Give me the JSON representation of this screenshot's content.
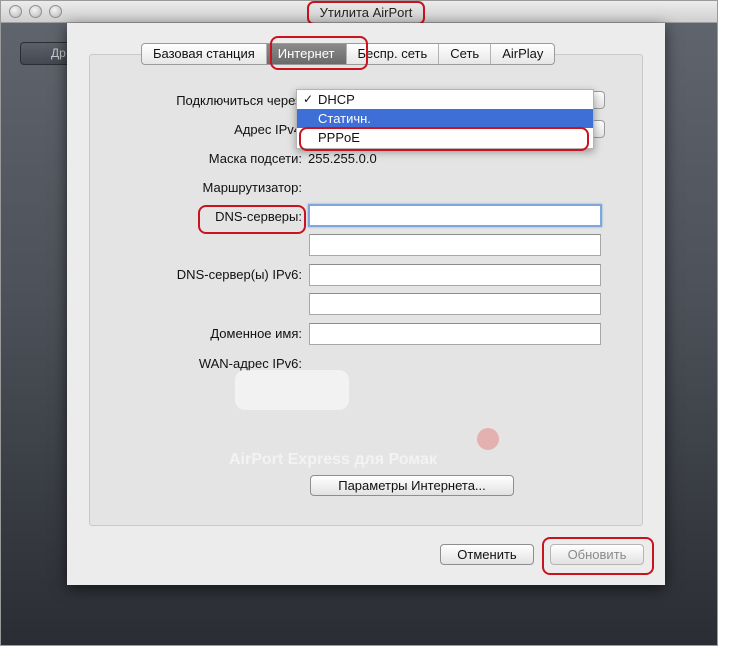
{
  "window": {
    "title": "Утилита AirPort",
    "back_label": "Др"
  },
  "tabs": [
    {
      "label": "Базовая станция"
    },
    {
      "label": "Интернет"
    },
    {
      "label": "Беспр. сеть"
    },
    {
      "label": "Сеть"
    },
    {
      "label": "AirPlay"
    }
  ],
  "form": {
    "connect_label": "Подключиться через",
    "ipv4_label": "Адрес IPv4",
    "subnet_label": "Маска подсети:",
    "subnet_value": "255.255.0.0",
    "router_label": "Маршрутизатор:",
    "dns_label": "DNS-серверы:",
    "dns1_value": "",
    "dns2_value": "",
    "dns_ipv6_label": "DNS-сервер(ы) IPv6:",
    "dns_ipv6_1_value": "",
    "dns_ipv6_2_value": "",
    "domain_label": "Доменное имя:",
    "domain_value": "",
    "wan_ipv6_label": "WAN-адрес IPv6:"
  },
  "dropdown": {
    "check": "✓",
    "options": [
      "DHCP",
      "Статичн.",
      "PPPoE"
    ],
    "selected": "DHCP",
    "highlighted": "Статичн."
  },
  "background": {
    "device_name": "AirPort Express для Ромак"
  },
  "buttons": {
    "internet_options": "Параметры Интернета...",
    "cancel": "Отменить",
    "update": "Обновить"
  },
  "colors": {
    "annotation_red": "#c8141e",
    "menu_highlight": "#3d6fd6",
    "focus_ring": "#7fa7dc"
  }
}
